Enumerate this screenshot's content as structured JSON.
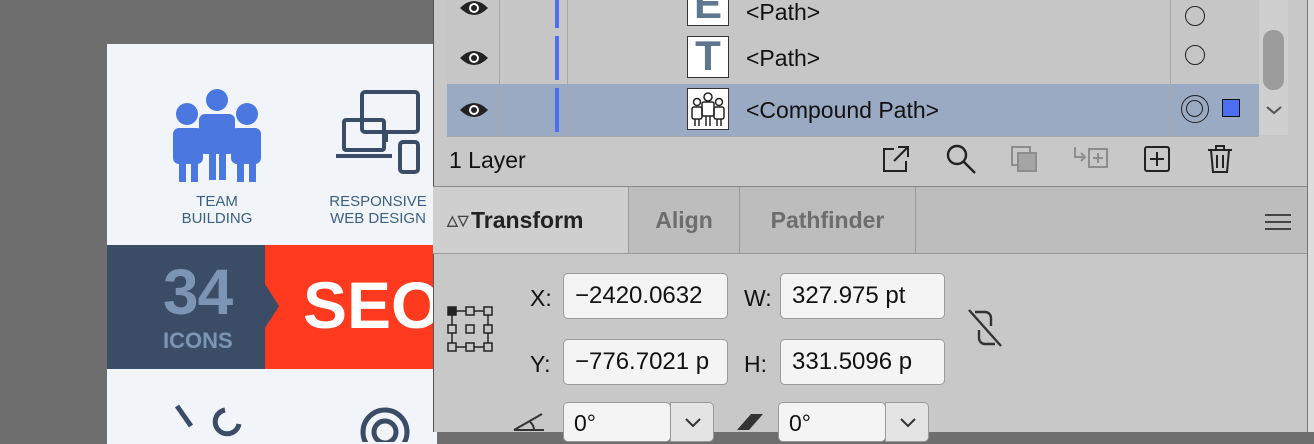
{
  "artboard": {
    "captions": [
      "TEAM\nBUILDING",
      "RESPONSIVE\nWEB DESIGN"
    ],
    "caption1_line1": "TEAM",
    "caption1_line2": "BUILDING",
    "caption2_line1": "RESPONSIVE",
    "caption2_line2": "WEB DESIGN",
    "banner_number": "34",
    "banner_icons_word": "ICONS",
    "banner_seo": "SEO",
    "colors": {
      "banner_dark": "#3b4d66",
      "banner_red": "#ff3a1f",
      "icon_blue": "#4a78e0",
      "text_blue": "#3d5f80"
    }
  },
  "layers": {
    "rows": [
      {
        "name": "<Path>",
        "thumb": "E",
        "selected": false
      },
      {
        "name": "<Path>",
        "thumb": "T",
        "selected": false
      },
      {
        "name": "<Compound Path>",
        "thumb": "team",
        "selected": true
      }
    ],
    "count_label": "1 Layer",
    "footer_icons": [
      "export-icon",
      "search-icon",
      "clipping-mask-icon",
      "move-to-layer-icon",
      "new-layer-icon",
      "trash-icon"
    ]
  },
  "transform_panel": {
    "tabs": [
      "Transform",
      "Align",
      "Pathfinder"
    ],
    "active_tab": "Transform",
    "x_label": "X:",
    "x_value": "−2420.0632",
    "y_label": "Y:",
    "y_value": "−776.7021 p",
    "w_label": "W:",
    "w_value": "327.975 pt",
    "h_label": "H:",
    "h_value": "331.5096 p",
    "rotate_value": "0°",
    "shear_value": "0°"
  }
}
